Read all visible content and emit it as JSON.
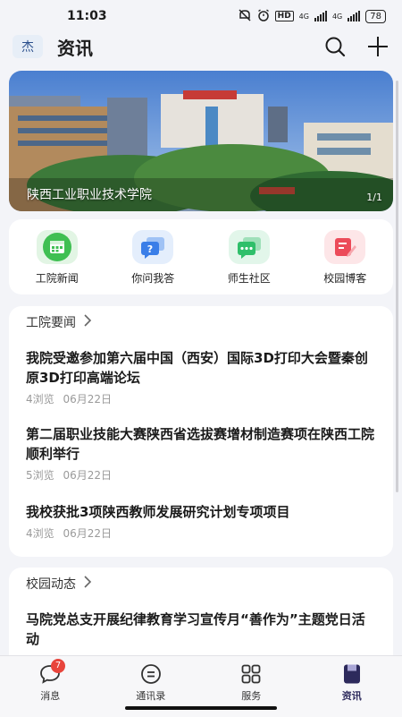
{
  "status": {
    "time": "11:03",
    "hd": "HD",
    "net1": "4G",
    "net2": "4G",
    "battery": "78"
  },
  "header": {
    "logo_text": "杰",
    "title": "资讯"
  },
  "banner": {
    "caption": "陕西工业职业技术学院",
    "page": "1/1"
  },
  "quick_links": [
    {
      "label": "工院新闻",
      "icon": "calendar-icon",
      "color": "#3fbf52"
    },
    {
      "label": "你问我答",
      "icon": "question-chat-icon",
      "color": "#3a7ee8"
    },
    {
      "label": "师生社区",
      "icon": "community-chat-icon",
      "color": "#2fbf6a"
    },
    {
      "label": "校园博客",
      "icon": "blog-edit-icon",
      "color": "#ec4b5a"
    }
  ],
  "news_section": {
    "title": "工院要闻",
    "items": [
      {
        "title": "我院受邀参加第六届中国（西安）国际3D打印大会暨秦创原3D打印高端论坛",
        "views": "4浏览",
        "date": "06月22日"
      },
      {
        "title": "第二届职业技能大赛陕西省选拔赛增材制造赛项在陕西工院顺利举行",
        "views": "5浏览",
        "date": "06月22日"
      },
      {
        "title": "我校获批3项陕西教师发展研究计划专项项目",
        "views": "4浏览",
        "date": "06月22日"
      }
    ]
  },
  "campus_section": {
    "title": "校园动态",
    "items": [
      {
        "title": "马院党总支开展纪律教育学习宣传月“善作为”主题党日活动"
      }
    ]
  },
  "bottom_nav": [
    {
      "label": "消息",
      "icon": "message-icon",
      "badge": "7"
    },
    {
      "label": "通讯录",
      "icon": "contacts-icon"
    },
    {
      "label": "服务",
      "icon": "grid-icon"
    },
    {
      "label": "资讯",
      "icon": "news-icon",
      "active": true
    }
  ]
}
